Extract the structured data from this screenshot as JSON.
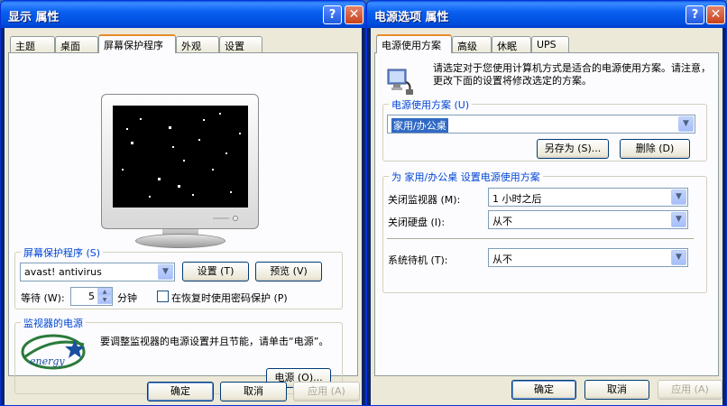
{
  "display": {
    "title": "显示 属性",
    "tabs": [
      "主题",
      "桌面",
      "屏幕保护程序",
      "外观",
      "设置"
    ],
    "screensaver": {
      "legend": "屏幕保护程序 (S)",
      "selected": "avast! antivirus",
      "settings_button": "设置 (T)",
      "preview_button": "预览 (V)",
      "wait_label": "等待 (W):",
      "wait_value": "5",
      "minutes_label": "分钟",
      "password_checkbox": "在恢复时使用密码保护 (P)",
      "password_checked": false
    },
    "monitor_power": {
      "legend": "监视器的电源",
      "description": "要调整监视器的电源设置并且节能，请单击“电源”。",
      "power_button": "电源 (O)...",
      "logo_text": "energy"
    },
    "buttons": {
      "ok": "确定",
      "cancel": "取消",
      "apply": "应用 (A)"
    }
  },
  "power": {
    "title": "电源选项 属性",
    "tabs": [
      "电源使用方案",
      "高级",
      "休眠",
      "UPS"
    ],
    "intro": "请选定对于您使用计算机方式是适合的电源使用方案。请注意，更改下面的设置将修改选定的方案。",
    "scheme": {
      "legend": "电源使用方案 (U)",
      "selected": "家用/办公桌",
      "save_as_button": "另存为 (S)...",
      "delete_button": "删除 (D)"
    },
    "settings": {
      "legend": "为 家用/办公桌 设置电源使用方案",
      "rows": [
        {
          "label": "关闭监视器 (M):",
          "value": "1 小时之后"
        },
        {
          "label": "关闭硬盘 (I):",
          "value": "从不"
        },
        {
          "label": "系统待机 (T):",
          "value": "从不"
        }
      ]
    },
    "buttons": {
      "ok": "确定",
      "cancel": "取消",
      "apply": "应用 (A)"
    }
  },
  "colors": {
    "title_bar": "#0054e3",
    "face": "#ece9d8",
    "accent_tab": "#e68b2c",
    "legend": "#0046d5",
    "selection": "#316ac5"
  },
  "icons": [
    "help-icon",
    "close-icon",
    "dropdown-arrow-icon",
    "energy-star-logo",
    "power-plug-icon",
    "spin-up-icon",
    "spin-down-icon"
  ]
}
